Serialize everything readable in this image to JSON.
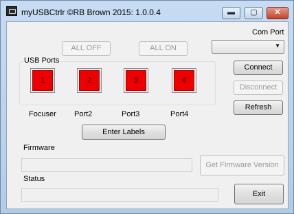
{
  "window": {
    "title": "myUSBCtrlr ©RB Brown 2015: 1.0.0.4",
    "minimize_glyph": "▬",
    "maximize_glyph": "▢",
    "close_glyph": "✕"
  },
  "com_port": {
    "label": "Com Port",
    "selected": "",
    "arrow_glyph": "▼"
  },
  "buttons": {
    "all_off": "ALL OFF",
    "all_on": "ALL ON",
    "connect": "Connect",
    "disconnect": "Disconnect",
    "refresh": "Refresh",
    "enter_labels": "Enter Labels",
    "get_firmware": "Get Firmware Version",
    "exit": "Exit"
  },
  "usb_ports": {
    "group_title": "USB Ports",
    "on_color": "#ee0000",
    "ports": [
      {
        "number": "1",
        "label": "Focuser"
      },
      {
        "number": "2",
        "label": "Port2"
      },
      {
        "number": "3",
        "label": "Port3"
      },
      {
        "number": "4",
        "label": "Port4"
      }
    ]
  },
  "firmware": {
    "label": "Firmware",
    "value": ""
  },
  "status": {
    "label": "Status",
    "value": ""
  }
}
